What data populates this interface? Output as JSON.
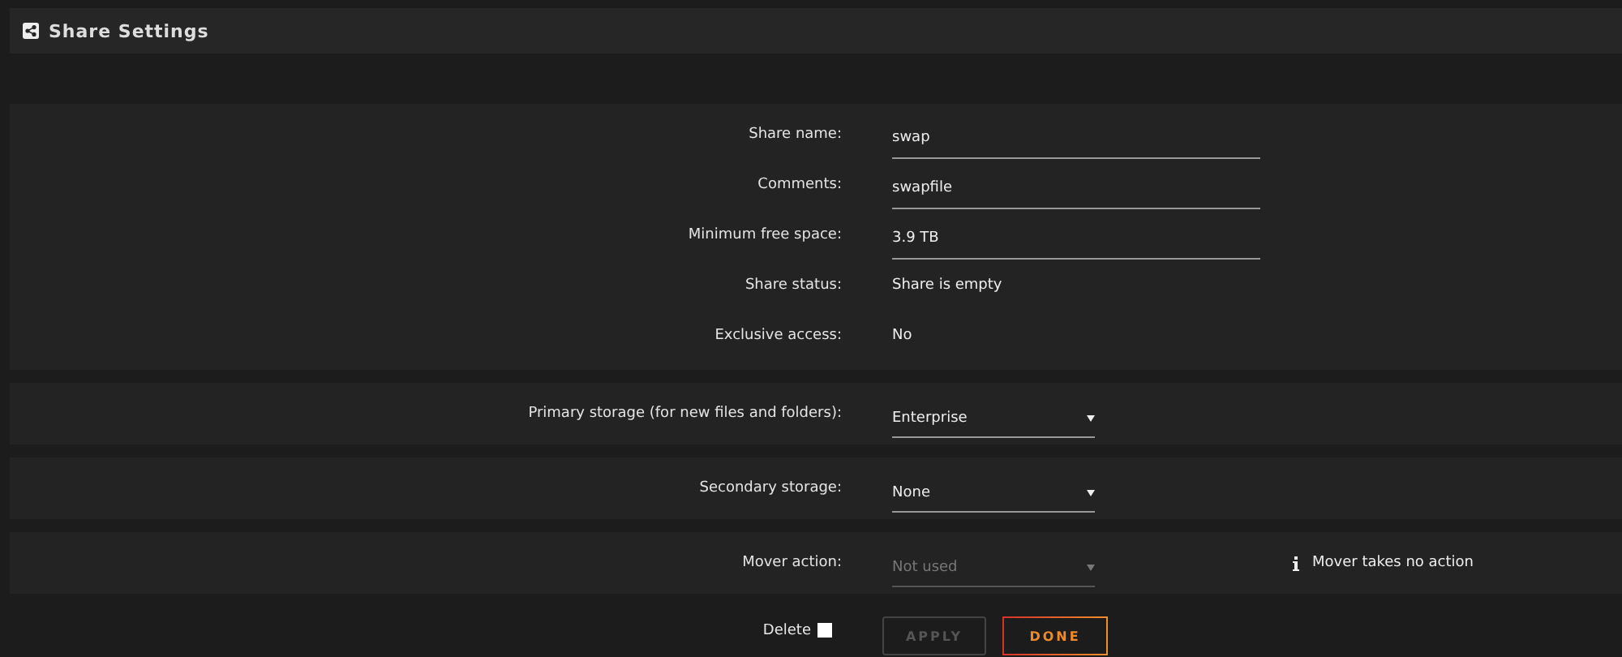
{
  "header": {
    "title": "Share Settings"
  },
  "sections": [
    {
      "rows": [
        {
          "kind": "input",
          "label": "Share name:",
          "value": "swap"
        },
        {
          "kind": "input",
          "label": "Comments:",
          "value": "swapfile"
        },
        {
          "kind": "input",
          "label": "Minimum free space:",
          "value": "3.9 TB"
        },
        {
          "kind": "static",
          "label": "Share status:",
          "value": "Share is empty"
        },
        {
          "kind": "static",
          "label": "Exclusive access:",
          "value": "No"
        }
      ]
    },
    {
      "rows": [
        {
          "kind": "select",
          "label": "Primary storage (for new files and folders):",
          "value": "Enterprise",
          "disabled": false
        }
      ]
    },
    {
      "rows": [
        {
          "kind": "select",
          "label": "Secondary storage:",
          "value": "None",
          "disabled": false
        }
      ]
    },
    {
      "rows": [
        {
          "kind": "select",
          "label": "Mover action:",
          "value": "Not used",
          "disabled": true,
          "note": "Mover takes no action"
        }
      ]
    }
  ],
  "footer": {
    "delete": {
      "label": "Delete",
      "checked": false
    },
    "buttons": [
      {
        "label": "APPLY",
        "disabled": true,
        "kind": "apply"
      },
      {
        "label": "DONE",
        "disabled": false,
        "kind": "done"
      }
    ]
  }
}
